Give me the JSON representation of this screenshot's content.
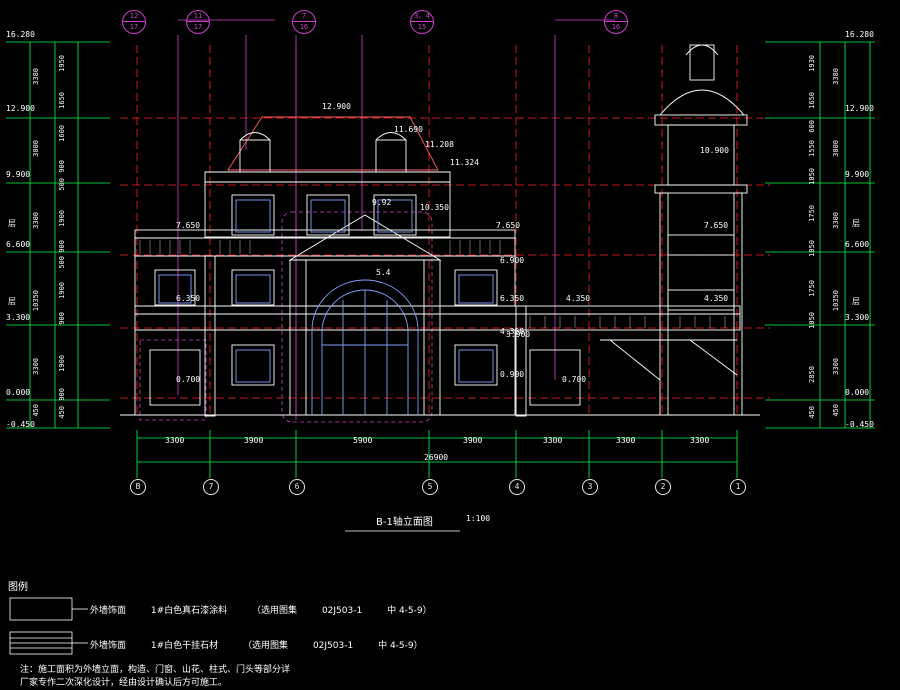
{
  "drawing": {
    "title": "B-1轴立面图",
    "scale": "1:100",
    "total_width": "26900",
    "bay_dims": [
      "3300",
      "3900",
      "5900",
      "3900",
      "3300",
      "3300",
      "3300"
    ],
    "axes": [
      "B",
      "7",
      "6",
      "5",
      "4",
      "3",
      "2",
      "1"
    ],
    "tags": [
      {
        "top": "12",
        "bottom": "17"
      },
      {
        "top": "11",
        "bottom": "17"
      },
      {
        "top": "7",
        "bottom": "16"
      },
      {
        "top": "3、4",
        "bottom": "15"
      },
      {
        "top": "8",
        "bottom": "16"
      }
    ],
    "left_levels": [
      "16.280",
      "12.900",
      "9.900",
      "6.600",
      "3.300",
      "0.000",
      "-0.450"
    ],
    "right_levels": [
      "16.280",
      "12.900",
      "9.900",
      "6.600",
      "3.300",
      "0.000",
      "-0.450"
    ],
    "left_dims_outer": [
      "3380",
      "3000",
      "3300",
      "10350",
      "3300",
      "450"
    ],
    "left_dims_inner": [
      "1950",
      "1650",
      "1600",
      "900",
      "500",
      "1900",
      "900",
      "500",
      "1900",
      "900",
      "1900",
      "900",
      "450"
    ],
    "right_dims_outer": [
      "3380",
      "3000",
      "3300",
      "10350",
      "3300",
      "450"
    ],
    "right_dims_inner": [
      "1930",
      "1650",
      "600",
      "1550",
      "1050",
      "1750",
      "1050",
      "1750",
      "1050",
      "2850",
      "450"
    ],
    "plan_marks": [
      "12.900",
      "11.690",
      "11.208",
      "11.324",
      "10.900",
      "10.350",
      "9.92",
      "7.650",
      "7.650",
      "7.650",
      "6.900",
      "6.350",
      "6.350",
      "5.4",
      "4.350",
      "4.350",
      "4.350",
      "3.900",
      "0.700",
      "0.900",
      "0.700"
    ],
    "markers": [
      "层",
      "层",
      "层",
      "层"
    ]
  },
  "legend": {
    "title": "图例",
    "rows": [
      {
        "desc": "外墙饰面",
        "material": "1#白色真石漆涂料",
        "ref": "（选用图集",
        "code": "02J503-1",
        "page": "中 4-5-9）"
      },
      {
        "desc": "外墙饰面",
        "material": "1#白色干挂石材",
        "ref": "（选用图集",
        "code": "02J503-1",
        "page": "中 4-5-9）"
      }
    ],
    "note_line1": "注：施工面积为外墙立面，构造、门窗、山花、柱式、门头等部分详",
    "note_line2": "    厂家专作二次深化设计，经由设计确认后方可施工。"
  },
  "colors": {
    "background": "#000000",
    "building": "#ffffff",
    "grid": "#ff2020",
    "dimension": "#00ff40",
    "tag": "#d040d0",
    "glazing": "#80a0ff",
    "roof": "#ff6060"
  }
}
